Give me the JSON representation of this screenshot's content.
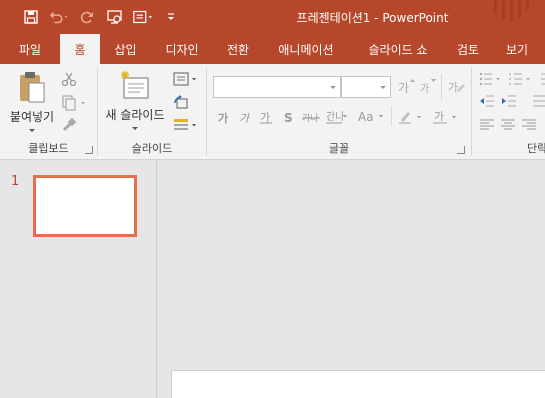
{
  "app": {
    "title": "프레젠테이션1  -  PowerPoint",
    "accent_color": "#b7472a"
  },
  "quick_access": {
    "icons": [
      "save-icon",
      "undo-icon",
      "redo-icon",
      "from-beginning-icon",
      "layout-icon",
      "customize-qat-icon"
    ]
  },
  "tabs": [
    {
      "label": "파일"
    },
    {
      "label": "홈"
    },
    {
      "label": "삽입"
    },
    {
      "label": "디자인"
    },
    {
      "label": "전환"
    },
    {
      "label": "애니메이션"
    },
    {
      "label": "슬라이드 쇼"
    },
    {
      "label": "검토"
    },
    {
      "label": "보기"
    }
  ],
  "active_tab": "홈",
  "ribbon": {
    "clipboard": {
      "label": "클립보드",
      "paste_label": "붙여넣기"
    },
    "slides": {
      "label": "슬라이드",
      "new_slide_label": "새 슬라이드"
    },
    "font": {
      "label": "글꼴",
      "font_name_value": "",
      "font_size_value": ""
    },
    "paragraph": {
      "label": "단락"
    }
  },
  "thumbnails": [
    {
      "number": "1"
    }
  ]
}
